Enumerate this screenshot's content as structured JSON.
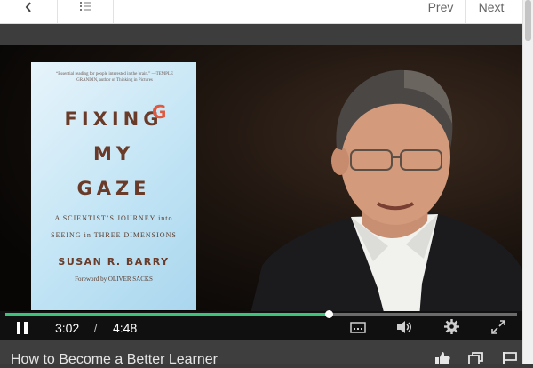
{
  "topbar": {
    "back_icon": "chevron-left-icon",
    "toc_icon": "list-icon",
    "prev_label": "Prev",
    "next_label": "Next"
  },
  "book_cover": {
    "quote": "“Essential reading for people interested in the brain.” —TEMPLE GRANDIN, author of Thinking in Pictures",
    "title_lines": [
      "FIXING",
      "MY",
      "GAZE"
    ],
    "subtitle_line1": "A SCIENTIST’S JOURNEY into",
    "subtitle_line2": "SEEING in THREE DIMENSIONS",
    "author": "SUSAN R. BARRY",
    "foreword": "Foreword by OLIVER SACKS"
  },
  "player": {
    "current_time": "3:02",
    "time_separator": "/",
    "duration": "4:48",
    "progress_fraction": 0.632,
    "accent_color": "#3fc27b",
    "icons": [
      "pause-icon",
      "captions-icon",
      "volume-icon",
      "settings-icon",
      "fullscreen-icon"
    ]
  },
  "video_title": "How to Become a Better Learner",
  "actions": {
    "icons": [
      "thumbs-up-icon",
      "copy-icon",
      "flag-icon"
    ]
  }
}
